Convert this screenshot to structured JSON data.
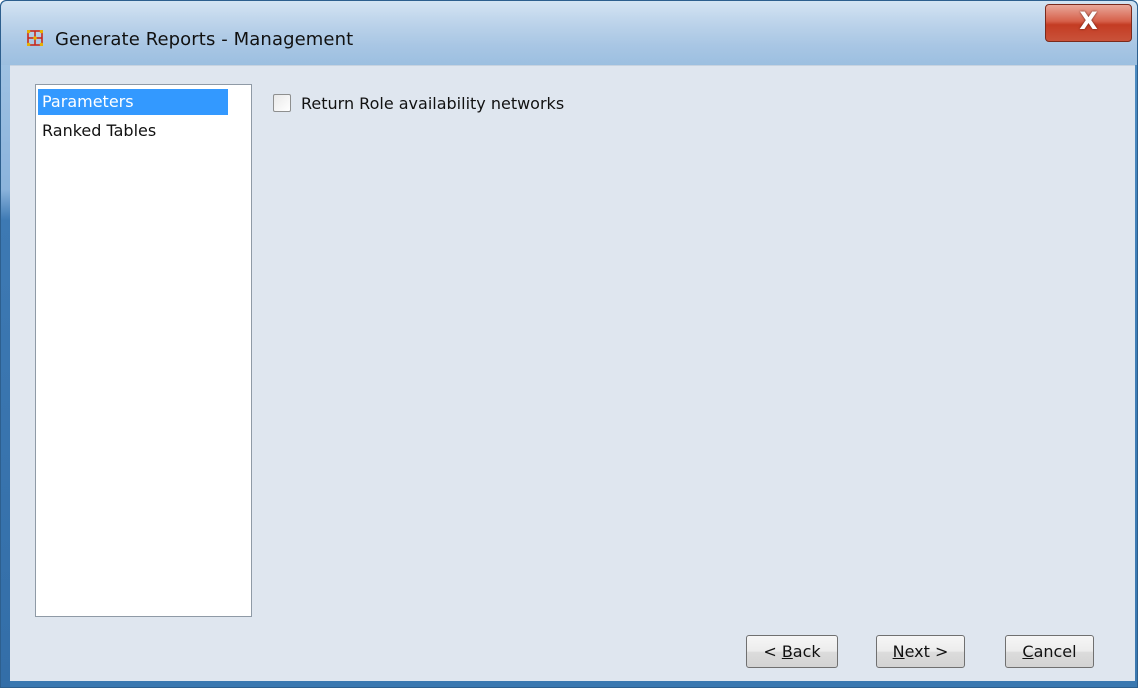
{
  "window": {
    "title": "Generate Reports - Management",
    "app_icon": "network-grid-icon",
    "close_glyph": "X"
  },
  "nav": {
    "items": [
      {
        "label": "Parameters",
        "selected": true
      },
      {
        "label": "Ranked Tables",
        "selected": false
      }
    ]
  },
  "parameters": {
    "checkbox_label": "Return Role availability networks",
    "checked": false
  },
  "buttons": {
    "back": {
      "prefix": "< ",
      "mnemonic": "B",
      "rest": "ack"
    },
    "next": {
      "prefix": "",
      "mnemonic": "N",
      "rest": "ext >"
    },
    "cancel": {
      "prefix": "",
      "mnemonic": "C",
      "rest": "ancel"
    }
  },
  "colors": {
    "selection": "#3399ff",
    "client_bg": "#dfe6ef",
    "close_red": "#c43c23"
  }
}
